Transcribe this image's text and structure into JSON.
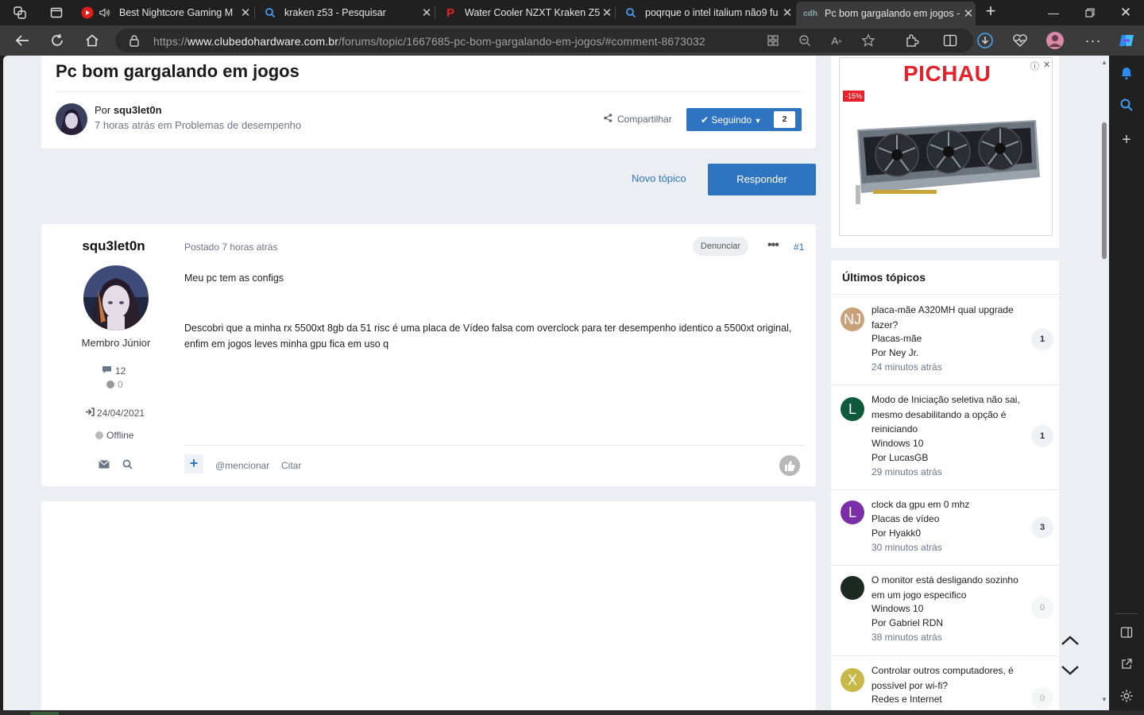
{
  "browser": {
    "tabs": [
      {
        "title": "Best Nightcore Gaming M",
        "icon": "youtube-icon"
      },
      {
        "title": "kraken z53 - Pesquisar",
        "icon": "bing-search-icon"
      },
      {
        "title": "Water Cooler NZXT Kraken Z5",
        "icon": "pichau-icon"
      },
      {
        "title": "poqrque o intel italium não9 fu",
        "icon": "bing-search-icon"
      },
      {
        "title": "Pc bom gargalando em jogos -",
        "icon": "cdh-icon",
        "active": true
      }
    ],
    "url_prefix": "https://",
    "url_domain": "www.clubedohardware.com.br",
    "url_path": "/forums/topic/1667685-pc-bom-gargalando-em-jogos/#comment-8673032"
  },
  "topic": {
    "title": "Pc bom gargalando em jogos",
    "by_prefix": "Por",
    "author": "squ3let0n",
    "meta": "7 horas atrás em Problemas de desempenho",
    "share_label": "Compartilhar",
    "follow_label": "Seguindo",
    "follow_count": "2"
  },
  "actions": {
    "new_topic": "Novo tópico",
    "reply": "Responder"
  },
  "post": {
    "author": "squ3let0n",
    "rank": "Membro Júnior",
    "posts_count": "12",
    "reputation": "0",
    "joined": "24/04/2021",
    "status": "Offline",
    "posted": "Postado 7 horas atrás",
    "report": "Denunciar",
    "number": "#1",
    "paragraph1": "Meu pc tem as configs",
    "paragraph2": "Descobri que a minha rx 5500xt 8gb da 51 risc é uma placa de Vídeo falsa com overclock para ter desempenho identico a 5500xt original, enfim em jogos leves minha gpu fica em uso q",
    "mention": "@mencionar",
    "quote": "Citar"
  },
  "ad": {
    "brand": "PICHAU",
    "discount": "-15%"
  },
  "latest": {
    "heading": "Últimos tópicos",
    "items": [
      {
        "initials": "NJ",
        "color": "#c9a27c",
        "title": "placa-mãe A320MH qual upgrade fazer?",
        "forum": "Placas-mãe",
        "by": "Por Ney Jr.",
        "time": "24 minutos atrás",
        "count": "1"
      },
      {
        "initials": "L",
        "color": "#0e5a3c",
        "title": "Modo de Iniciação seletiva não sai, mesmo desabilitando a opção é reiniciando",
        "forum": "Windows 10",
        "by": "Por LucasGB",
        "time": "29 minutos atrás",
        "count": "1"
      },
      {
        "initials": "L",
        "color": "#7b2ea8",
        "title": "clock da gpu em 0 mhz",
        "forum": "Placas de vídeo",
        "by": "Por Hyakk0",
        "time": "30 minutos atrás",
        "count": "3"
      },
      {
        "initials": "",
        "color": "#1d2a22",
        "title": "O monitor está desligando sozinho em um jogo especifico",
        "forum": "Windows 10",
        "by": "Por Gabriel RDN",
        "time": "38 minutos atrás",
        "count": "0"
      },
      {
        "initials": "X",
        "color": "#c8b84a",
        "title": "Controlar outros computadores, é possível por wi-fi?",
        "forum": "Redes e Internet",
        "by": "",
        "time": "",
        "count": "0"
      }
    ]
  }
}
